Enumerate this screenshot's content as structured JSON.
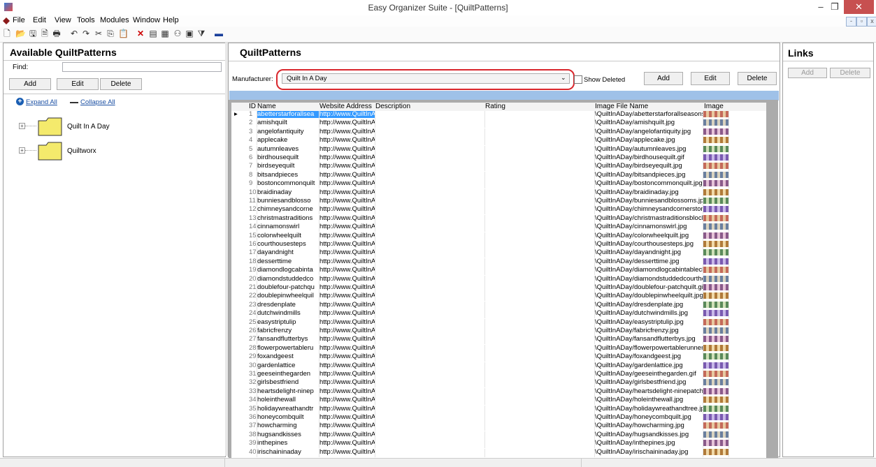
{
  "window": {
    "title": "Easy Organizer Suite - [QuiltPatterns]",
    "minimize": "–",
    "maximize": "❐",
    "close": "✕"
  },
  "menu": {
    "items": [
      "File",
      "Edit",
      "View",
      "Tools",
      "Modules",
      "Window",
      "Help"
    ]
  },
  "left": {
    "title": "Available QuiltPatterns",
    "find_label": "Find:",
    "find_value": "",
    "add": "Add",
    "edit": "Edit",
    "delete": "Delete",
    "expand_all": "Expand All",
    "collapse_all": "Collapse All",
    "tree": [
      {
        "label": "Quilt In A Day"
      },
      {
        "label": "Quiltworx"
      }
    ]
  },
  "main": {
    "title": "QuiltPatterns",
    "manufacturer_label": "Manufacturer:",
    "manufacturer_value": "Quilt In A Day",
    "show_deleted": "Show Deleted",
    "add": "Add",
    "edit": "Edit",
    "delete": "Delete",
    "columns": [
      "ID",
      "Name",
      "Website Address",
      "Description",
      "Rating",
      "Image File Name",
      "Image"
    ],
    "rows": [
      {
        "id": "1",
        "name": "abetterstarforallsea",
        "url": "http://www.QuiltInA",
        "file": "\\QuiltInADay/abetterstarforallseasons.jp"
      },
      {
        "id": "2",
        "name": "amishquilt",
        "url": "http://www.QuiltInA",
        "file": "\\QuiltInADay/amishquilt.jpg"
      },
      {
        "id": "3",
        "name": "angelofantiquity",
        "url": "http://www.QuiltInA",
        "file": "\\QuiltInADay/angelofantiquity.jpg"
      },
      {
        "id": "4",
        "name": "applecake",
        "url": "http://www.QuiltInA",
        "file": "\\QuiltInADay/applecake.jpg"
      },
      {
        "id": "5",
        "name": "autumnleaves",
        "url": "http://www.QuiltInA",
        "file": "\\QuiltInADay/autumnleaves.jpg"
      },
      {
        "id": "6",
        "name": "birdhousequilt",
        "url": "http://www.QuiltInA",
        "file": "\\QuiltInADay/birdhousequilt.gif"
      },
      {
        "id": "7",
        "name": "birdseyequilt",
        "url": "http://www.QuiltInA",
        "file": "\\QuiltInADay/birdseyequilt.jpg"
      },
      {
        "id": "8",
        "name": "bitsandpieces",
        "url": "http://www.QuiltInA",
        "file": "\\QuiltInADay/bitsandpieces.jpg"
      },
      {
        "id": "9",
        "name": "bostoncommonquilt",
        "url": "http://www.QuiltInA",
        "file": "\\QuiltInADay/bostoncommonquilt.jpg"
      },
      {
        "id": "10",
        "name": "braidinaday",
        "url": "http://www.QuiltInA",
        "file": "\\QuiltInADay/braidinaday.jpg"
      },
      {
        "id": "11",
        "name": "bunniesandblosso",
        "url": "http://www.QuiltInA",
        "file": "\\QuiltInADay/bunniesandblossoms.jpg"
      },
      {
        "id": "12",
        "name": "chimneysandcorne",
        "url": "http://www.QuiltInA",
        "file": "\\QuiltInADay/chimneysandcornerstones"
      },
      {
        "id": "13",
        "name": "christmastraditions",
        "url": "http://www.QuiltInA",
        "file": "\\QuiltInADay/christmastraditionsblockpa"
      },
      {
        "id": "14",
        "name": "cinnamonswirl",
        "url": "http://www.QuiltInA",
        "file": "\\QuiltInADay/cinnamonswirl.jpg"
      },
      {
        "id": "15",
        "name": "colorwheelquilt",
        "url": "http://www.QuiltInA",
        "file": "\\QuiltInADay/colorwheelquilt.jpg"
      },
      {
        "id": "16",
        "name": "courthousesteps",
        "url": "http://www.QuiltInA",
        "file": "\\QuiltInADay/courthousesteps.jpg"
      },
      {
        "id": "17",
        "name": "dayandnight",
        "url": "http://www.QuiltInA",
        "file": "\\QuiltInADay/dayandnight.jpg"
      },
      {
        "id": "18",
        "name": "desserttime",
        "url": "http://www.QuiltInA",
        "file": "\\QuiltInADay/desserttime.jpg"
      },
      {
        "id": "19",
        "name": "diamondlogcabinta",
        "url": "http://www.QuiltInA",
        "file": "\\QuiltInADay/diamondlogcabintablecloth"
      },
      {
        "id": "20",
        "name": "diamondstuddedco",
        "url": "http://www.QuiltInA",
        "file": "\\QuiltInADay/diamondstuddedcourthous"
      },
      {
        "id": "21",
        "name": "doublefour-patchqu",
        "url": "http://www.QuiltInA",
        "file": "\\QuiltInADay/doublefour-patchquilt.gif"
      },
      {
        "id": "22",
        "name": "doublepinwheelquil",
        "url": "http://www.QuiltInA",
        "file": "\\QuiltInADay/doublepinwheelquilt.jpg"
      },
      {
        "id": "23",
        "name": "dresdenplate",
        "url": "http://www.QuiltInA",
        "file": "\\QuiltInADay/dresdenplate.jpg"
      },
      {
        "id": "24",
        "name": "dutchwindmills",
        "url": "http://www.QuiltInA",
        "file": "\\QuiltInADay/dutchwindmills.jpg"
      },
      {
        "id": "25",
        "name": "easystriptulip",
        "url": "http://www.QuiltInA",
        "file": "\\QuiltInADay/easystriptulip.jpg"
      },
      {
        "id": "26",
        "name": "fabricfrenzy",
        "url": "http://www.QuiltInA",
        "file": "\\QuiltInADay/fabricfrenzy.jpg"
      },
      {
        "id": "27",
        "name": "fansandflutterbys",
        "url": "http://www.QuiltInA",
        "file": "\\QuiltInADay/fansandflutterbys.jpg"
      },
      {
        "id": "28",
        "name": "flowerpowertableru",
        "url": "http://www.QuiltInA",
        "file": "\\QuiltInADay/flowerpowertablerunner.jp"
      },
      {
        "id": "29",
        "name": "foxandgeest",
        "url": "http://www.QuiltInA",
        "file": "\\QuiltInADay/foxandgeest.jpg"
      },
      {
        "id": "30",
        "name": "gardenlattice",
        "url": "http://www.QuiltInA",
        "file": "\\QuiltInADay/gardenlattice.jpg"
      },
      {
        "id": "31",
        "name": "geeseinthegarden",
        "url": "http://www.QuiltInA",
        "file": "\\QuiltInADay/geeseinthegarden.gif"
      },
      {
        "id": "32",
        "name": "girlsbestfriend",
        "url": "http://www.QuiltInA",
        "file": "\\QuiltInADay/girlsbestfriend.jpg"
      },
      {
        "id": "33",
        "name": "heartsdelight-ninep",
        "url": "http://www.QuiltInA",
        "file": "\\QuiltInADay/heartsdelight-ninepatchvar"
      },
      {
        "id": "34",
        "name": "holeinthewall",
        "url": "http://www.QuiltInA",
        "file": "\\QuiltInADay/holeinthewall.jpg"
      },
      {
        "id": "35",
        "name": "holidaywreathandtr",
        "url": "http://www.QuiltInA",
        "file": "\\QuiltInADay/holidaywreathandtree.jpg"
      },
      {
        "id": "36",
        "name": "honeycombquilt",
        "url": "http://www.QuiltInA",
        "file": "\\QuiltInADay/honeycombquilt.jpg"
      },
      {
        "id": "37",
        "name": "howcharming",
        "url": "http://www.QuiltInA",
        "file": "\\QuiltInADay/howcharming.jpg"
      },
      {
        "id": "38",
        "name": "hugsandkisses",
        "url": "http://www.QuiltInA",
        "file": "\\QuiltInADay/hugsandkisses.jpg"
      },
      {
        "id": "39",
        "name": "inthepines",
        "url": "http://www.QuiltInA",
        "file": "\\QuiltInADay/inthepines.jpg"
      },
      {
        "id": "40",
        "name": "irischaininaday",
        "url": "http://www.QuiltInA",
        "file": "\\QuiltInADay/irischaininaday.jpg"
      }
    ]
  },
  "links": {
    "title": "Links",
    "add": "Add",
    "delete": "Delete"
  },
  "colors": {
    "selection": "#3399ff",
    "highlight_ring": "#d9262c",
    "folder": "#f4ea6c",
    "close_button": "#c75050"
  }
}
